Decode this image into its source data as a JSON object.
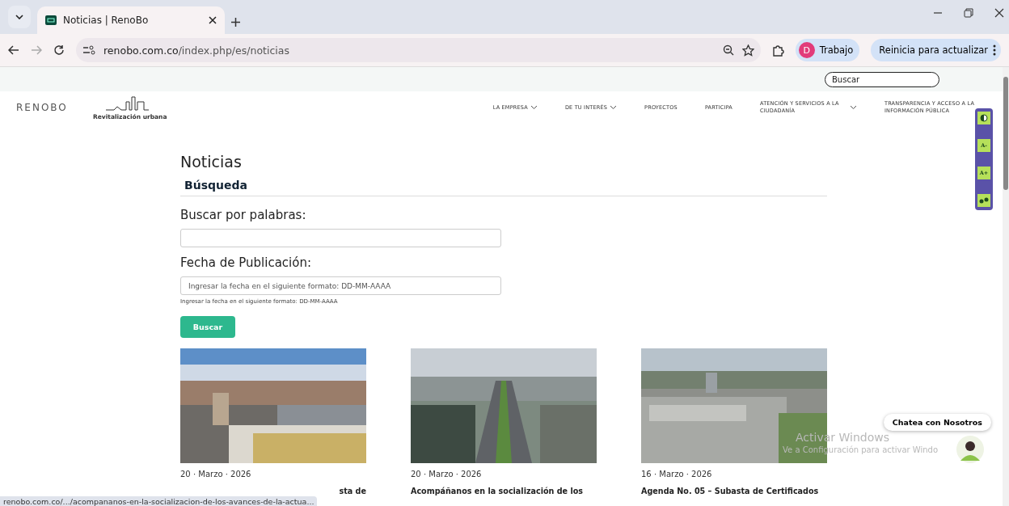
{
  "browser": {
    "tab_title": "Noticias | RenoBo",
    "address_host": "renobo.com.co",
    "address_path": "/index.php/es/noticias",
    "profile_initial": "D",
    "profile_label": "Trabajo",
    "update_button": "Reinicia para actualizar"
  },
  "site": {
    "search_placeholder": "Buscar",
    "logo_text": "RENOBO",
    "logo_caption": "Revitalización urbana",
    "nav": [
      {
        "label": "LA EMPRESA",
        "dropdown": true
      },
      {
        "label": "DE TU INTERÉS",
        "dropdown": true
      },
      {
        "label": "PROYECTOS",
        "dropdown": false
      },
      {
        "label": "PARTICIPA",
        "dropdown": false
      },
      {
        "label": "ATENCIÓN Y SERVICIOS A LA CIUDADANÍA",
        "dropdown": true
      },
      {
        "label": "TRANSPARENCIA Y ACCESO A LA INFORMACIÓN PÚBLICA",
        "dropdown": false
      }
    ]
  },
  "page_title": "Noticias",
  "section_heading": "Búsqueda",
  "fields": [
    {
      "label": "Buscar por palabras:"
    },
    {
      "label": "Fecha de Publicación:",
      "placeholder": "Ingresar la fecha en el siguiente formato: DD-MM-AAAA",
      "help": "Ingresar la fecha en el siguiente formato: DD-MM-AAAA"
    }
  ],
  "search_button": "Buscar",
  "cards": [
    {
      "date": "20 · Marzo · 2026",
      "title": "sta de"
    },
    {
      "date": "20 · Marzo · 2026",
      "title": "Acompáñanos en la socialización de los"
    },
    {
      "date": "16 · Marzo · 2026",
      "title": "Agenda No. 05 – Subasta de Certificados"
    }
  ],
  "accessibility_tools": [
    {
      "kind": "contrast"
    },
    {
      "kind": "text",
      "label": "A-"
    },
    {
      "kind": "text",
      "label": "A+"
    },
    {
      "kind": "link"
    }
  ],
  "chat_label": "Chatea con Nosotros",
  "windows_notice": {
    "title": "Activar Windows",
    "subtitle": "Ve a Configuración para activar Windo"
  },
  "status_url": "renobo.com.co/.../acompananos-en-la-socializacion-de-los-avances-de-la-actua..."
}
